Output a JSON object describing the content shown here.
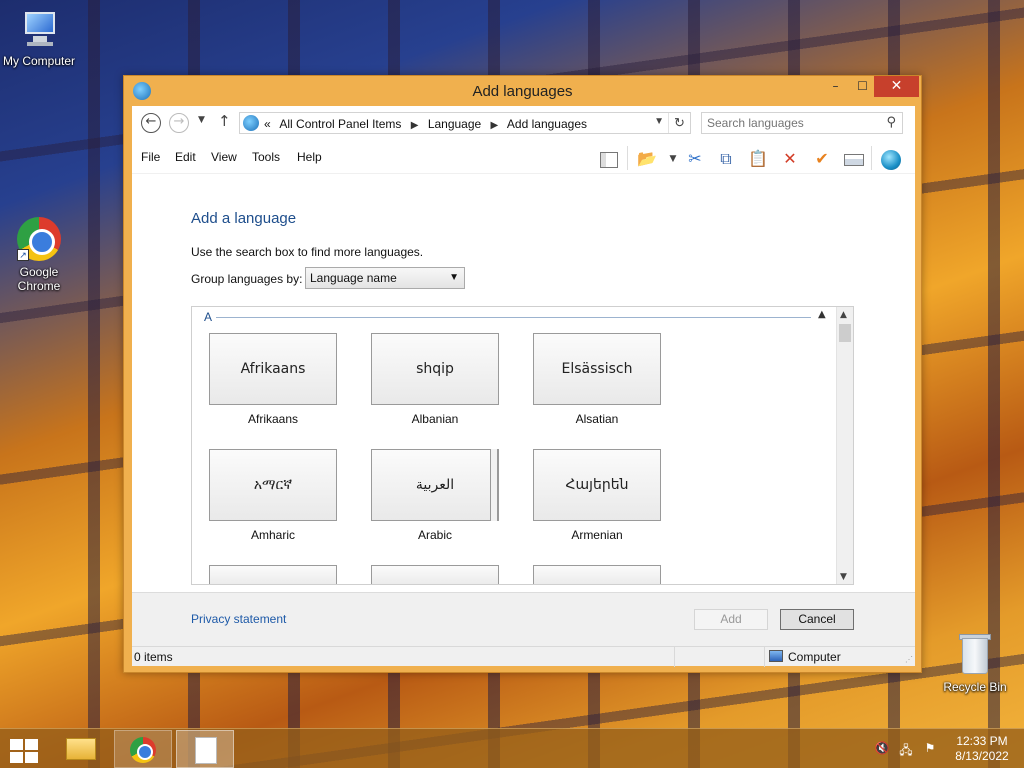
{
  "desktop": {
    "icons": [
      {
        "label": "My Computer"
      },
      {
        "label": "Google Chrome"
      },
      {
        "label": "Recycle Bin"
      }
    ]
  },
  "window": {
    "title": "Add languages",
    "controls": {
      "minimize": "–",
      "maximize": "☐",
      "close": "✕"
    }
  },
  "address": {
    "prefix": "«",
    "crumbs": [
      "All Control Panel Items",
      "Language",
      "Add languages"
    ],
    "search_placeholder": "Search languages"
  },
  "menu": [
    "File",
    "Edit",
    "View",
    "Tools",
    "Help"
  ],
  "content": {
    "heading": "Add a language",
    "hint": "Use the search box to find more languages.",
    "group_label": "Group languages by:",
    "group_value": "Language name",
    "group_letter": "A",
    "languages": [
      {
        "native": "Afrikaans",
        "name": "Afrikaans"
      },
      {
        "native": "shqip",
        "name": "Albanian"
      },
      {
        "native": "Elsässisch",
        "name": "Alsatian"
      },
      {
        "native": "አማርኛ",
        "name": "Amharic"
      },
      {
        "native": "العربية",
        "name": "Arabic"
      },
      {
        "native": "Հայերեն",
        "name": "Armenian"
      }
    ]
  },
  "footer": {
    "privacy": "Privacy statement",
    "add": "Add",
    "cancel": "Cancel"
  },
  "status": {
    "items": "0 items",
    "location": "Computer"
  },
  "taskbar": {
    "time": "12:33 PM",
    "date": "8/13/2022"
  },
  "colors": {
    "window_frame": "#f0b04e",
    "close_button": "#c7402c",
    "link_blue": "#1e5aa8"
  }
}
